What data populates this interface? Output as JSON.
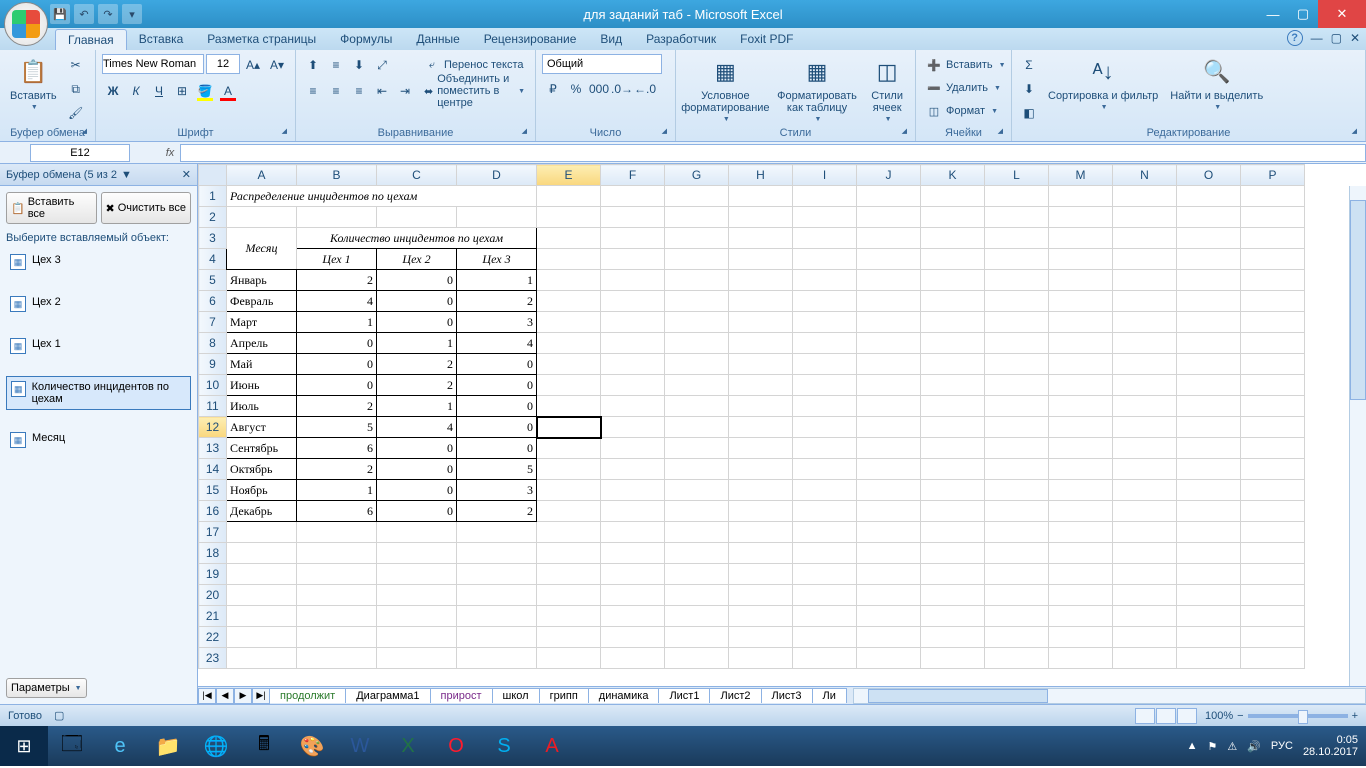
{
  "title": "для заданий таб - Microsoft Excel",
  "tabs": [
    "Главная",
    "Вставка",
    "Разметка страницы",
    "Формулы",
    "Данные",
    "Рецензирование",
    "Вид",
    "Разработчик",
    "Foxit PDF"
  ],
  "active_tab": "Главная",
  "ribbon": {
    "clipboard": {
      "label": "Буфер обмена",
      "paste": "Вставить"
    },
    "font": {
      "label": "Шрифт",
      "name": "Times New Roman",
      "size": "12"
    },
    "alignment": {
      "label": "Выравнивание",
      "wrap": "Перенос текста",
      "merge": "Объединить и поместить в центре"
    },
    "number": {
      "label": "Число",
      "format": "Общий"
    },
    "styles": {
      "label": "Стили",
      "cond": "Условное форматирование",
      "fmt_table": "Форматировать как таблицу",
      "cell_styles": "Стили ячеек"
    },
    "cells": {
      "label": "Ячейки",
      "insert": "Вставить",
      "delete": "Удалить",
      "format": "Формат"
    },
    "editing": {
      "label": "Редактирование",
      "sort": "Сортировка и фильтр",
      "find": "Найти и выделить"
    }
  },
  "name_box": "E12",
  "taskpane": {
    "title": "Буфер обмена (5 из 2",
    "paste_all": "Вставить все",
    "clear_all": "Очистить все",
    "hint": "Выберите вставляемый объект:",
    "items": [
      "Цех 3",
      "Цех 2",
      "Цех 1",
      "Количество инцидентов по цехам",
      "Месяц"
    ],
    "selected_index": 3,
    "options": "Параметры"
  },
  "columns": [
    "A",
    "B",
    "C",
    "D",
    "E",
    "F",
    "G",
    "H",
    "I",
    "J",
    "K",
    "L",
    "M",
    "N",
    "O",
    "P"
  ],
  "active_cell": {
    "row": 12,
    "col": "E"
  },
  "sheet": {
    "title_cell": "Распределение инцидентов по цехам",
    "month_label": "Месяц",
    "group_header": "Количество инцидентов по цехам",
    "col_headers": [
      "Цех 1",
      "Цех 2",
      "Цех 3"
    ],
    "rows": [
      {
        "m": "Январь",
        "v": [
          2,
          0,
          1
        ]
      },
      {
        "m": "Февраль",
        "v": [
          4,
          0,
          2
        ]
      },
      {
        "m": "Март",
        "v": [
          1,
          0,
          3
        ]
      },
      {
        "m": "Апрель",
        "v": [
          0,
          1,
          4
        ]
      },
      {
        "m": "Май",
        "v": [
          0,
          2,
          0
        ]
      },
      {
        "m": "Июнь",
        "v": [
          0,
          2,
          0
        ]
      },
      {
        "m": "Июль",
        "v": [
          2,
          1,
          0
        ]
      },
      {
        "m": "Август",
        "v": [
          5,
          4,
          0
        ]
      },
      {
        "m": "Сентябрь",
        "v": [
          6,
          0,
          0
        ]
      },
      {
        "m": "Октябрь",
        "v": [
          2,
          0,
          5
        ]
      },
      {
        "m": "Ноябрь",
        "v": [
          1,
          0,
          3
        ]
      },
      {
        "m": "Декабрь",
        "v": [
          6,
          0,
          2
        ]
      }
    ]
  },
  "sheet_tabs": [
    {
      "name": "продолжит",
      "color": "c-green"
    },
    {
      "name": "Диаграмма1",
      "color": ""
    },
    {
      "name": "прирост",
      "color": "c-purple"
    },
    {
      "name": "школ",
      "color": ""
    },
    {
      "name": "грипп",
      "color": ""
    },
    {
      "name": "динамика",
      "color": ""
    },
    {
      "name": "Лист1",
      "color": ""
    },
    {
      "name": "Лист2",
      "color": ""
    },
    {
      "name": "Лист3",
      "color": ""
    },
    {
      "name": "Ли",
      "color": ""
    }
  ],
  "status": "Готово",
  "zoom": "100%",
  "tray": {
    "lang": "РУС",
    "time": "0:05",
    "date": "28.10.2017"
  }
}
